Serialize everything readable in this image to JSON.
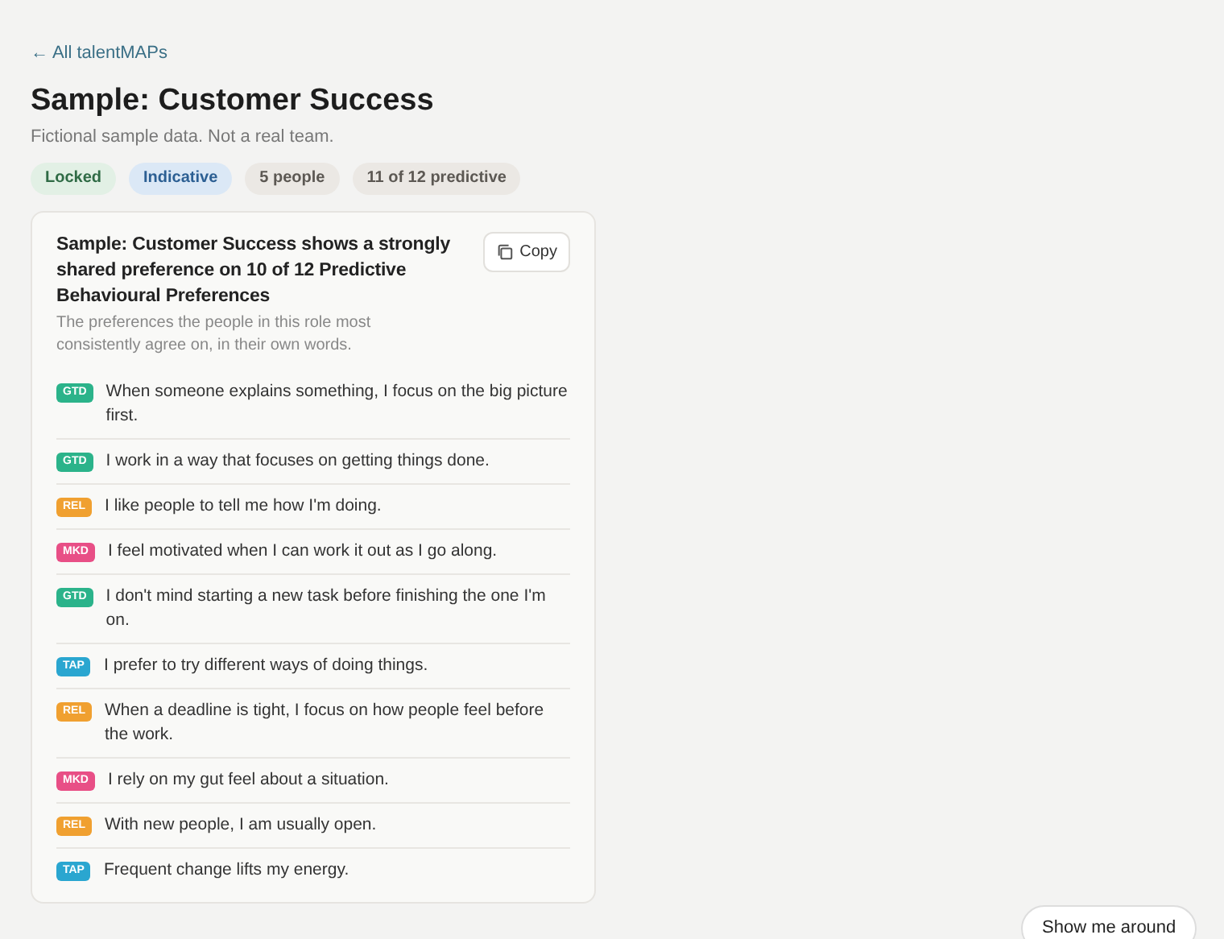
{
  "back_link": "← All talentMAPs",
  "title": "Sample: Customer Success",
  "subtitle": "Fictional sample data. Not a real team.",
  "badges": [
    {
      "label": "Locked",
      "kind": "success"
    },
    {
      "label": "Indicative",
      "kind": "info"
    },
    {
      "label": "5 people",
      "kind": "neutral"
    },
    {
      "label": "11 of 12 predictive",
      "kind": "neutral"
    }
  ],
  "card": {
    "heading": "Sample: Customer Success shows a strongly shared preference on 10 of 12 Predictive Behavioural Preferences",
    "description": "The preferences the people in this role most consistently agree on, in their own words.",
    "copy_button": "Copy",
    "items": [
      {
        "tag": "GTD",
        "color": "#2bb38a",
        "text": "When someone explains something, I focus on the big picture first."
      },
      {
        "tag": "GTD",
        "color": "#2bb38a",
        "text": "I work in a way that focuses on getting things done."
      },
      {
        "tag": "REL",
        "color": "#f0a030",
        "text": "I like people to tell me how I'm doing."
      },
      {
        "tag": "MKD",
        "color": "#e84f86",
        "text": "I feel motivated when I can work it out as I go along."
      },
      {
        "tag": "GTD",
        "color": "#2bb38a",
        "text": "I don't mind starting a new task before finishing the one I'm on."
      },
      {
        "tag": "TAP",
        "color": "#2aa6d0",
        "text": "I prefer to try different ways of doing things."
      },
      {
        "tag": "REL",
        "color": "#f0a030",
        "text": "When a deadline is tight, I focus on how people feel before the work."
      },
      {
        "tag": "MKD",
        "color": "#e84f86",
        "text": "I rely on my gut feel about a situation."
      },
      {
        "tag": "REL",
        "color": "#f0a030",
        "text": "With new people, I am usually open."
      },
      {
        "tag": "TAP",
        "color": "#2aa6d0",
        "text": "Frequent change lifts my energy."
      }
    ]
  },
  "tour_button": "Show me around"
}
